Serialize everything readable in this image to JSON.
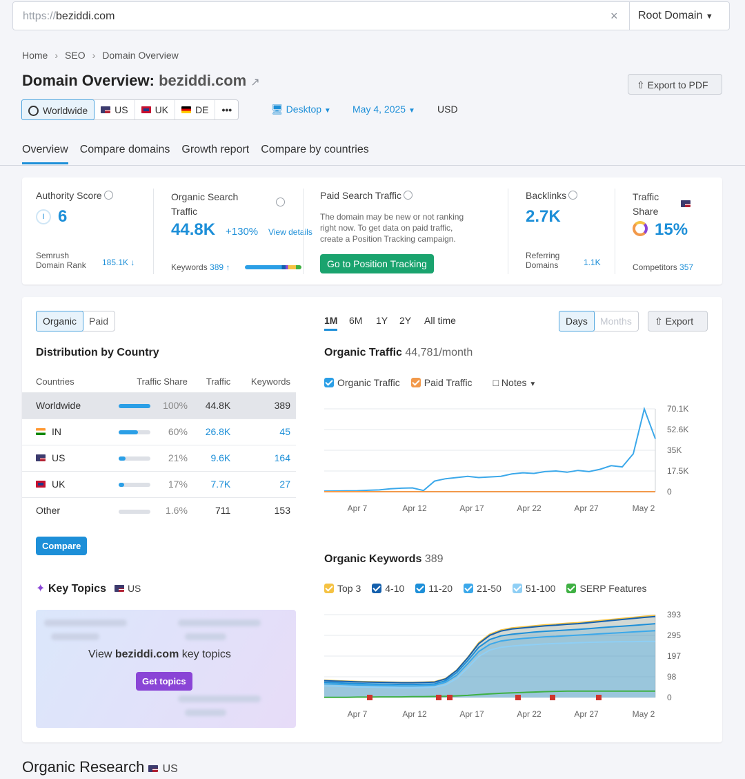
{
  "url_bar": {
    "protocol": "https://",
    "domain": "beziddi.com",
    "clear": "×",
    "scope": "Root Domain"
  },
  "breadcrumb": [
    "Home",
    "SEO",
    "Domain Overview"
  ],
  "page_title": {
    "prefix": "Domain Overview:",
    "domain": "beziddi.com"
  },
  "export_pdf": "Export to PDF",
  "databases": [
    {
      "label": "Worldwide",
      "icon": "globe-icon"
    },
    {
      "label": "US",
      "icon": "flag-us-icon"
    },
    {
      "label": "UK",
      "icon": "flag-uk-icon"
    },
    {
      "label": "DE",
      "icon": "flag-de-icon"
    },
    {
      "label": "•••",
      "icon": "more-icon"
    }
  ],
  "filters": {
    "device": "Desktop",
    "date": "May 4, 2025",
    "currency": "USD"
  },
  "tabs": [
    "Overview",
    "Compare domains",
    "Growth report",
    "Compare by countries"
  ],
  "metrics": {
    "authority": {
      "label": "Authority Score",
      "value": "6",
      "badge": "I",
      "rank_label1": "Semrush",
      "rank_label2": "Domain Rank",
      "rank_value": "185.1K ↓"
    },
    "organic": {
      "label1": "Organic Search",
      "label2": "Traffic",
      "value": "44.8K",
      "change": "+130%",
      "details": "View details",
      "keywords_label": "Keywords",
      "keywords_value": "389 ↑"
    },
    "paid": {
      "label": "Paid Search Traffic",
      "note1": "The domain may be new or not ranking",
      "note2": "right now. To get data on paid traffic,",
      "note3": "create a Position Tracking campaign.",
      "button": "Go to Position Tracking"
    },
    "backlinks": {
      "label": "Backlinks",
      "value": "2.7K",
      "ref_label1": "Referring",
      "ref_label2": "Domains",
      "ref_value": "1.1K"
    },
    "traffic_share": {
      "label1": "Traffic",
      "label2": "Share",
      "value": "15%",
      "competitors_label": "Competitors",
      "competitors_value": "357"
    }
  },
  "distribution": {
    "segment": [
      "Organic",
      "Paid"
    ],
    "title": "Distribution by Country",
    "columns": [
      "Countries",
      "Traffic Share",
      "Traffic",
      "Keywords"
    ],
    "rows": [
      {
        "country": "Worldwide",
        "share": "100%",
        "share_frac": 1.0,
        "traffic": "44.8K",
        "keywords": "389"
      },
      {
        "country": "IN",
        "share": "60%",
        "share_frac": 0.6,
        "traffic": "26.8K",
        "keywords": "45"
      },
      {
        "country": "US",
        "share": "21%",
        "share_frac": 0.21,
        "traffic": "9.6K",
        "keywords": "164"
      },
      {
        "country": "UK",
        "share": "17%",
        "share_frac": 0.17,
        "traffic": "7.7K",
        "keywords": "27"
      },
      {
        "country": "Other",
        "share": "1.6%",
        "share_frac": 0.016,
        "traffic": "711",
        "keywords": "153"
      }
    ],
    "compare_button": "Compare"
  },
  "key_topics": {
    "title": "Key Topics",
    "db": "US",
    "view_prefix": "View",
    "view_domain": "beziddi.com",
    "view_suffix": "key topics",
    "button": "Get topics"
  },
  "periods": [
    "1M",
    "6M",
    "1Y",
    "2Y",
    "All time"
  ],
  "granularity": [
    "Days",
    "Months"
  ],
  "export": "Export",
  "organic_traffic": {
    "title": "Organic Traffic",
    "subtitle": "44,781/month",
    "legend": [
      "Organic Traffic",
      "Paid Traffic"
    ],
    "notes": "Notes"
  },
  "organic_keywords": {
    "title": "Organic Keywords",
    "count": "389",
    "legend": [
      "Top 3",
      "4-10",
      "11-20",
      "21-50",
      "51-100",
      "SERP Features"
    ]
  },
  "organic_research": {
    "title": "Organic Research",
    "db": "US"
  },
  "colors": {
    "accent": "#1d8fd8",
    "green": "#1aa36e",
    "purple": "#8a45d6",
    "top3": "#f5c243",
    "k410": "#1560ad",
    "k1120": "#1d8fd8",
    "k2150": "#3ba8ea",
    "k51100": "#8fcff5",
    "serp": "#3fb043",
    "paid": "#f2994a"
  },
  "chart_data": [
    {
      "type": "line",
      "ylabel": "",
      "ylim": [
        0,
        70100
      ],
      "y_ticks": [
        "70.1K",
        "52.6K",
        "35K",
        "17.5K",
        "0"
      ],
      "x_ticks": [
        "Apr 7",
        "Apr 12",
        "Apr 17",
        "Apr 22",
        "Apr 27",
        "May 2"
      ],
      "x": [
        "Apr 4",
        "Apr 5",
        "Apr 6",
        "Apr 7",
        "Apr 8",
        "Apr 9",
        "Apr 10",
        "Apr 11",
        "Apr 12",
        "Apr 13",
        "Apr 14",
        "Apr 15",
        "Apr 16",
        "Apr 17",
        "Apr 18",
        "Apr 19",
        "Apr 20",
        "Apr 21",
        "Apr 22",
        "Apr 23",
        "Apr 24",
        "Apr 25",
        "Apr 26",
        "Apr 27",
        "Apr 28",
        "Apr 29",
        "Apr 30",
        "May 1",
        "May 2",
        "May 3",
        "May 4"
      ],
      "series": [
        {
          "name": "Organic Traffic",
          "values": [
            500,
            600,
            700,
            800,
            1200,
            1500,
            2500,
            3000,
            3200,
            1000,
            9000,
            11000,
            12000,
            13000,
            12000,
            12500,
            13000,
            15000,
            16000,
            15500,
            17000,
            17500,
            16500,
            18000,
            17000,
            19000,
            22000,
            21000,
            32000,
            70000,
            44781
          ]
        },
        {
          "name": "Paid Traffic",
          "values": [
            0,
            0,
            0,
            0,
            0,
            0,
            0,
            0,
            0,
            0,
            0,
            0,
            0,
            0,
            0,
            0,
            0,
            0,
            0,
            0,
            0,
            0,
            0,
            0,
            0,
            0,
            0,
            0,
            0,
            0,
            0
          ]
        }
      ]
    },
    {
      "type": "area",
      "ylabel": "",
      "ylim": [
        0,
        393
      ],
      "y_ticks": [
        "393",
        "295",
        "197",
        "98",
        "0"
      ],
      "x_ticks": [
        "Apr 7",
        "Apr 12",
        "Apr 17",
        "Apr 22",
        "Apr 27",
        "May 2"
      ],
      "series": [
        {
          "name": "Top 3",
          "values": [
            82,
            80,
            78,
            76,
            75,
            74,
            73,
            72,
            72,
            73,
            75,
            90,
            130,
            190,
            260,
            300,
            320,
            330,
            335,
            340,
            345,
            348,
            352,
            355,
            360,
            365,
            370,
            375,
            380,
            385,
            389
          ]
        },
        {
          "name": "4-10",
          "values": [
            80,
            78,
            76,
            74,
            73,
            72,
            71,
            70,
            70,
            71,
            73,
            88,
            128,
            188,
            255,
            295,
            315,
            325,
            330,
            335,
            340,
            343,
            347,
            350,
            355,
            360,
            365,
            370,
            375,
            380,
            384
          ]
        },
        {
          "name": "11-20",
          "values": [
            72,
            70,
            68,
            66,
            65,
            64,
            63,
            62,
            62,
            63,
            65,
            80,
            118,
            175,
            238,
            275,
            292,
            300,
            305,
            310,
            314,
            317,
            320,
            323,
            327,
            331,
            335,
            338,
            342,
            346,
            350
          ]
        },
        {
          "name": "21-50",
          "values": [
            65,
            63,
            61,
            59,
            58,
            57,
            56,
            55,
            55,
            56,
            58,
            72,
            105,
            160,
            218,
            252,
            268,
            275,
            280,
            284,
            288,
            290,
            293,
            296,
            299,
            302,
            305,
            308,
            311,
            314,
            317
          ]
        },
        {
          "name": "51-100",
          "values": [
            55,
            54,
            52,
            50,
            49,
            48,
            47,
            46,
            46,
            47,
            49,
            60,
            90,
            140,
            195,
            225,
            238,
            244,
            248,
            251,
            254,
            256,
            258,
            260,
            262,
            263,
            264,
            265,
            265,
            266,
            266
          ]
        },
        {
          "name": "SERP Features",
          "values": [
            1,
            1,
            1,
            2,
            2,
            3,
            3,
            3,
            4,
            4,
            5,
            6,
            8,
            10,
            14,
            17,
            20,
            22,
            24,
            26,
            28,
            29,
            30,
            30,
            30,
            30,
            30,
            30,
            30,
            30,
            30
          ]
        }
      ]
    }
  ]
}
